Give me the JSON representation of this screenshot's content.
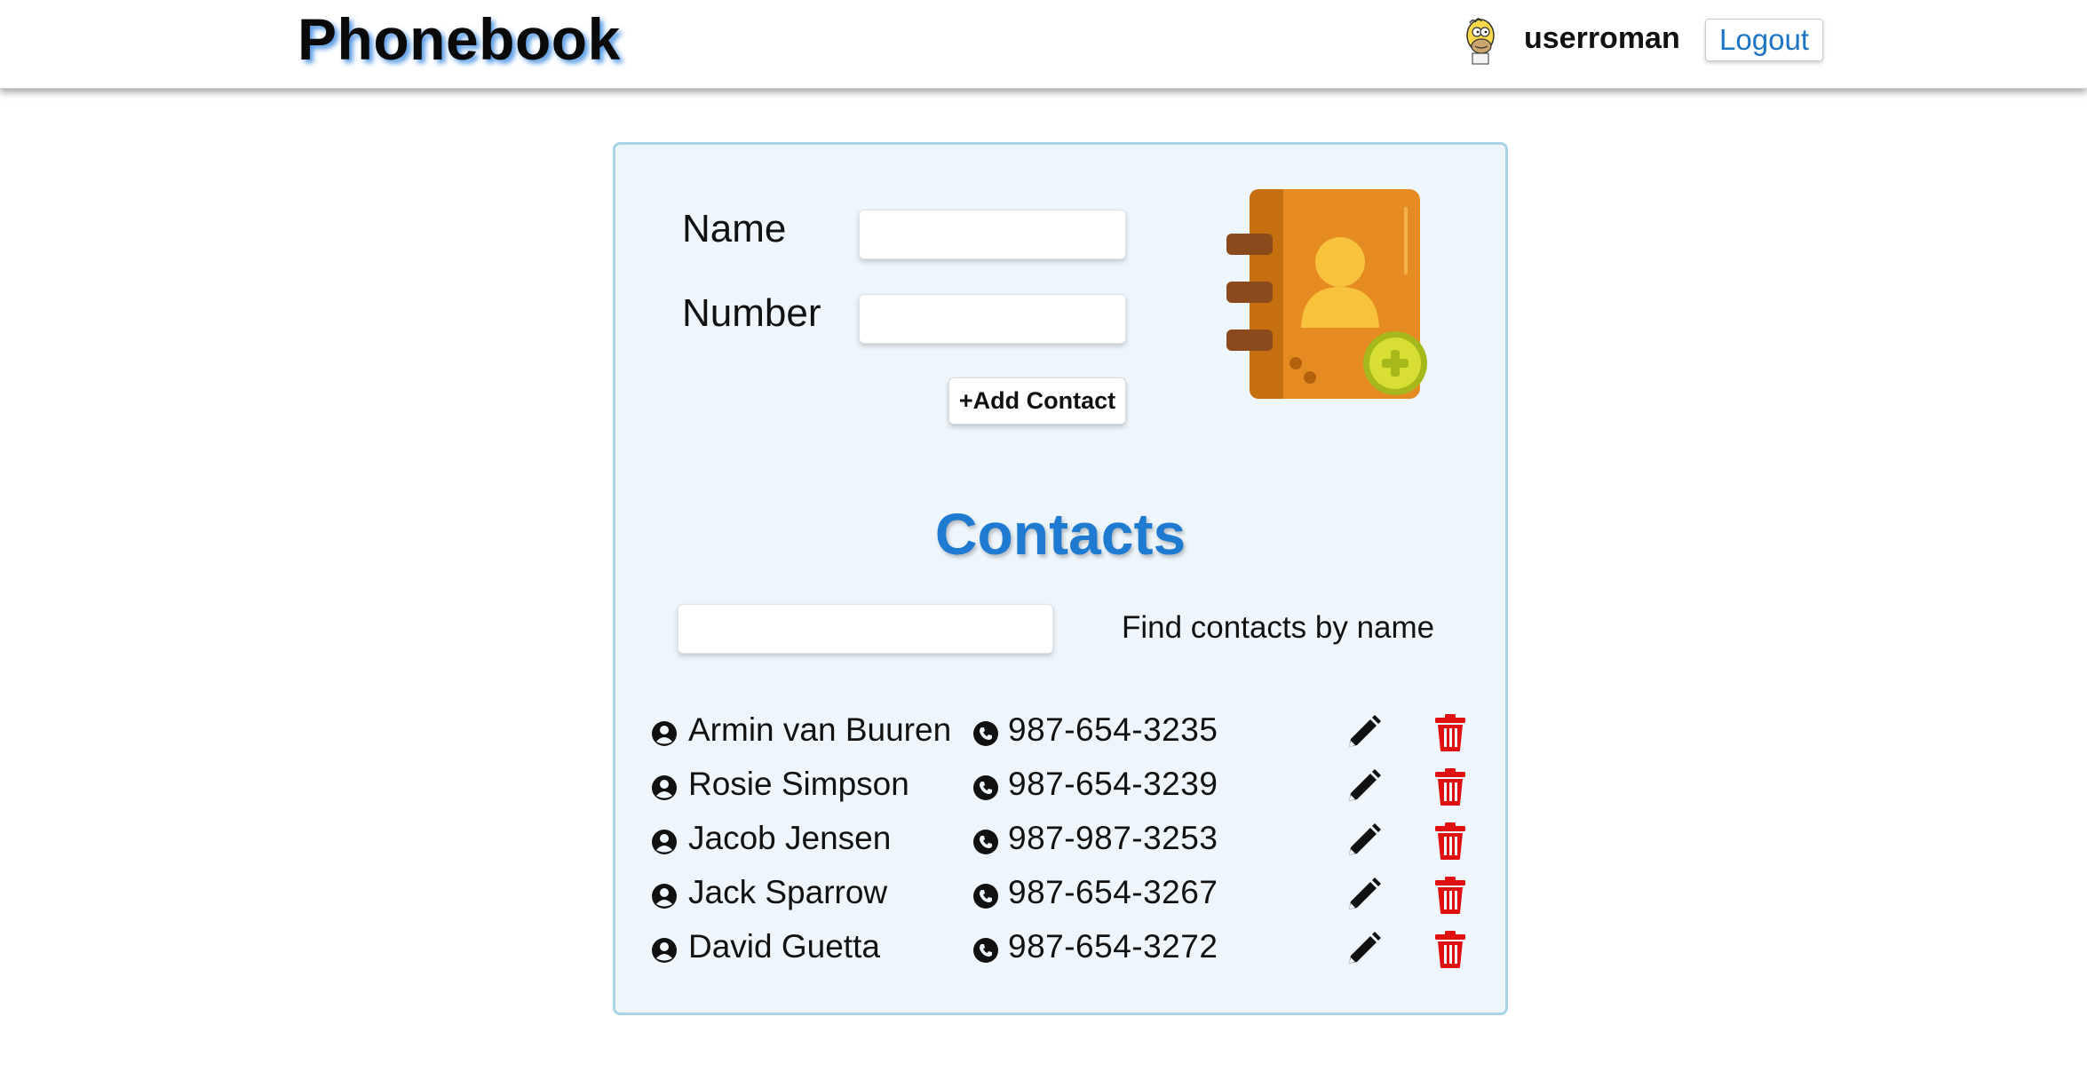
{
  "header": {
    "brand": "Phonebook",
    "username": "userroman",
    "logout_label": "Logout",
    "avatar_icon": "homer-avatar-icon"
  },
  "form": {
    "name_label": "Name",
    "name_value": "",
    "number_label": "Number",
    "number_value": "",
    "add_button_label": "+Add Contact",
    "illustration_icon": "address-book-add-icon"
  },
  "contacts": {
    "title": "Contacts",
    "filter_value": "",
    "filter_label": "Find contacts by name",
    "items": [
      {
        "name": "Armin van Buuren",
        "number": "987-654-3235"
      },
      {
        "name": "Rosie Simpson",
        "number": "987-654-3239"
      },
      {
        "name": "Jacob Jensen",
        "number": "987-987-3253"
      },
      {
        "name": "Jack Sparrow",
        "number": "987-654-3267"
      },
      {
        "name": "David Guetta",
        "number": "987-654-3272"
      }
    ]
  },
  "colors": {
    "brand_shadow": "#1e78dc",
    "title_blue": "#1f7bd1",
    "card_bg": "#eef6fc",
    "card_border": "#a9d4e6",
    "delete_red": "#e01010",
    "logout_text": "#1c74c4"
  }
}
